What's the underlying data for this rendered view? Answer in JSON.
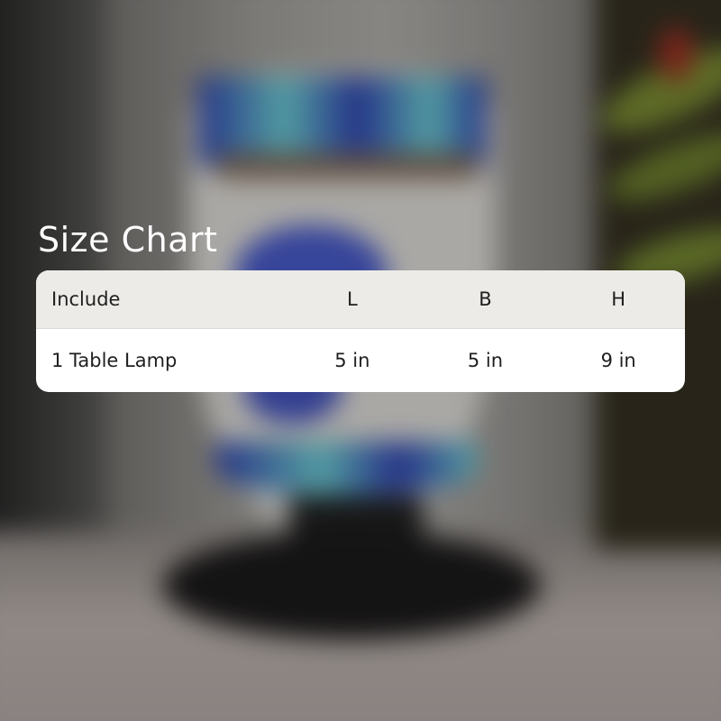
{
  "title": "Size Chart",
  "table": {
    "headers": {
      "include": "Include",
      "length": "L",
      "breadth": "B",
      "height": "H"
    },
    "rows": [
      {
        "include": "1 Table Lamp",
        "length": "5 in",
        "breadth": "5 in",
        "height": "9 in"
      }
    ]
  },
  "colors": {
    "title_text": "#ffffff",
    "header_bg": "#ecebe7",
    "body_bg": "#ffffff",
    "table_text": "#1f1f1f"
  },
  "background_photo": "blurred table lamp"
}
